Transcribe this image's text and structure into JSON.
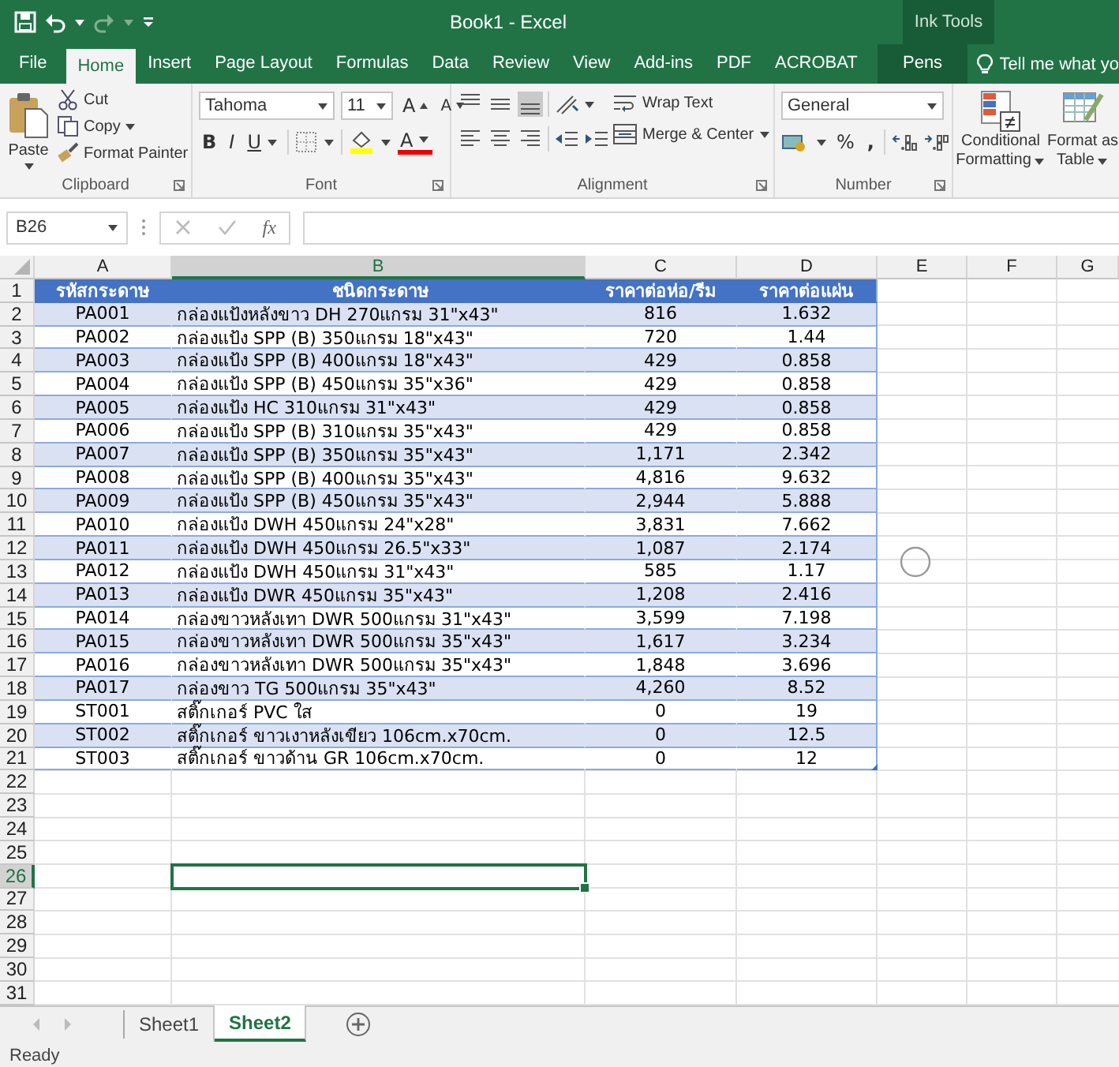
{
  "window": {
    "title": "Book1  -  Excel",
    "context_label": "Ink Tools"
  },
  "ribbon_tabs": [
    {
      "label": "File",
      "selected": false,
      "kind": "tab"
    },
    {
      "label": "Home",
      "selected": true,
      "kind": "tab"
    },
    {
      "label": "Insert",
      "selected": false,
      "kind": "tab"
    },
    {
      "label": "Page Layout",
      "selected": false,
      "kind": "tab"
    },
    {
      "label": "Formulas",
      "selected": false,
      "kind": "tab"
    },
    {
      "label": "Data",
      "selected": false,
      "kind": "tab"
    },
    {
      "label": "Review",
      "selected": false,
      "kind": "tab"
    },
    {
      "label": "View",
      "selected": false,
      "kind": "tab"
    },
    {
      "label": "Add-ins",
      "selected": false,
      "kind": "tab"
    },
    {
      "label": "PDF",
      "selected": false,
      "kind": "tab"
    },
    {
      "label": "ACROBAT",
      "selected": false,
      "kind": "tab"
    },
    {
      "label": "Pens",
      "selected": false,
      "kind": "contextual"
    }
  ],
  "tell_me": {
    "placeholder": "Tell me what yo"
  },
  "ribbon": {
    "clipboard": {
      "paste": "Paste",
      "cut": "Cut",
      "copy": "Copy",
      "format_painter": "Format Painter",
      "label": "Clipboard"
    },
    "font": {
      "font_name": "Tahoma",
      "font_size": "11",
      "grow": "A",
      "shrink": "A",
      "bold": "B",
      "italic": "I",
      "underline": "U",
      "font_color": "A",
      "label": "Font"
    },
    "alignment": {
      "vertical": [
        {
          "selected": false
        },
        {
          "selected": false
        },
        {
          "selected": true
        }
      ],
      "wrap_text": "Wrap Text",
      "merge_center": "Merge & Center",
      "label": "Alignment"
    },
    "number": {
      "format": "General",
      "percent": "%",
      "comma": ",",
      "label": "Number"
    },
    "styles": {
      "conditional_formatting": [
        "Conditional",
        "Formatting"
      ],
      "format_as_table": [
        "Format as",
        "Table"
      ]
    }
  },
  "formula_bar": {
    "name_box": "B26",
    "function_label": "fx"
  },
  "sheet": {
    "columns": [
      {
        "label": "A",
        "selected": false
      },
      {
        "label": "B",
        "selected": true
      },
      {
        "label": "C",
        "selected": false
      },
      {
        "label": "D",
        "selected": false
      },
      {
        "label": "E",
        "selected": false
      },
      {
        "label": "F",
        "selected": false
      },
      {
        "label": "G",
        "selected": false
      }
    ],
    "row_numbers": [
      {
        "label": "1",
        "selected": false
      },
      {
        "label": "2",
        "selected": false
      },
      {
        "label": "3",
        "selected": false
      },
      {
        "label": "4",
        "selected": false
      },
      {
        "label": "5",
        "selected": false
      },
      {
        "label": "6",
        "selected": false
      },
      {
        "label": "7",
        "selected": false
      },
      {
        "label": "8",
        "selected": false
      },
      {
        "label": "9",
        "selected": false
      },
      {
        "label": "10",
        "selected": false
      },
      {
        "label": "11",
        "selected": false
      },
      {
        "label": "12",
        "selected": false
      },
      {
        "label": "13",
        "selected": false
      },
      {
        "label": "14",
        "selected": false
      },
      {
        "label": "15",
        "selected": false
      },
      {
        "label": "16",
        "selected": false
      },
      {
        "label": "17",
        "selected": false
      },
      {
        "label": "18",
        "selected": false
      },
      {
        "label": "19",
        "selected": false
      },
      {
        "label": "20",
        "selected": false
      },
      {
        "label": "21",
        "selected": false
      },
      {
        "label": "22",
        "selected": false
      },
      {
        "label": "23",
        "selected": false
      },
      {
        "label": "24",
        "selected": false
      },
      {
        "label": "25",
        "selected": false
      },
      {
        "label": "26",
        "selected": true
      },
      {
        "label": "27",
        "selected": false
      },
      {
        "label": "28",
        "selected": false
      },
      {
        "label": "29",
        "selected": false
      },
      {
        "label": "30",
        "selected": false
      },
      {
        "label": "31",
        "selected": false
      }
    ],
    "header": [
      "รหัสกระดาษ",
      "ชนิดกระดาษ",
      "ราคาต่อห่อ/รีม",
      "ราคาต่อแผ่น"
    ],
    "rows": [
      [
        "PA001",
        "กล่องแป้งหลังขาว DH 270แกรม 31\"x43\"",
        "816",
        "1.632"
      ],
      [
        "PA002",
        "กล่องแป้ง SPP (B) 350แกรม 18\"x43\"",
        "720",
        "1.44"
      ],
      [
        "PA003",
        "กล่องแป้ง SPP (B) 400แกรม 18\"x43\"",
        "429",
        "0.858"
      ],
      [
        "PA004",
        "กล่องแป้ง SPP (B) 450แกรม 35\"x36\"",
        "429",
        "0.858"
      ],
      [
        "PA005",
        "กล่องแป้ง HC 310แกรม 31\"x43\"",
        "429",
        "0.858"
      ],
      [
        "PA006",
        "กล่องแป้ง SPP (B) 310แกรม 35\"x43\"",
        "429",
        "0.858"
      ],
      [
        "PA007",
        "กล่องแป้ง SPP (B) 350แกรม 35\"x43\"",
        "1,171",
        "2.342"
      ],
      [
        "PA008",
        "กล่องแป้ง SPP (B) 400แกรม 35\"x43\"",
        "4,816",
        "9.632"
      ],
      [
        "PA009",
        "กล่องแป้ง SPP (B) 450แกรม 35\"x43\"",
        "2,944",
        "5.888"
      ],
      [
        "PA010",
        "กล่องแป้ง DWH 450แกรม 24\"x28\"",
        "3,831",
        "7.662"
      ],
      [
        "PA011",
        "กล่องแป้ง DWH 450แกรม 26.5\"x33\"",
        "1,087",
        "2.174"
      ],
      [
        "PA012",
        "กล่องแป้ง DWH 450แกรม 31\"x43\"",
        "585",
        "1.17"
      ],
      [
        "PA013",
        "กล่องแป้ง DWR 450แกรม 35\"x43\"",
        "1,208",
        "2.416"
      ],
      [
        "PA014",
        "กล่องขาวหลังเทา DWR 500แกรม 31\"x43\"",
        "3,599",
        "7.198"
      ],
      [
        "PA015",
        "กล่องขาวหลังเทา DWR 500แกรม 35\"x43\"",
        "1,617",
        "3.234"
      ],
      [
        "PA016",
        "กล่องขาวหลังเทา DWR 500แกรม 35\"x43\"",
        "1,848",
        "3.696"
      ],
      [
        "PA017",
        "กล่องขาว TG 500แกรม 35\"x43\"",
        "4,260",
        "8.52"
      ],
      [
        "ST001",
        "สติ๊กเกอร์ PVC ใส",
        "0",
        "19"
      ],
      [
        "ST002",
        "สติ๊กเกอร์ ขาวเงาหลังเขียว 106cm.x70cm.",
        "0",
        "12.5"
      ],
      [
        "ST003",
        "สติ๊กเกอร์ ขาวด้าน GR 106cm.x70cm.",
        "0",
        "12"
      ]
    ]
  },
  "sheet_tabs": [
    {
      "label": "Sheet1",
      "selected": false
    },
    {
      "label": "Sheet2",
      "selected": true
    }
  ],
  "status_bar": {
    "text": "Ready"
  }
}
